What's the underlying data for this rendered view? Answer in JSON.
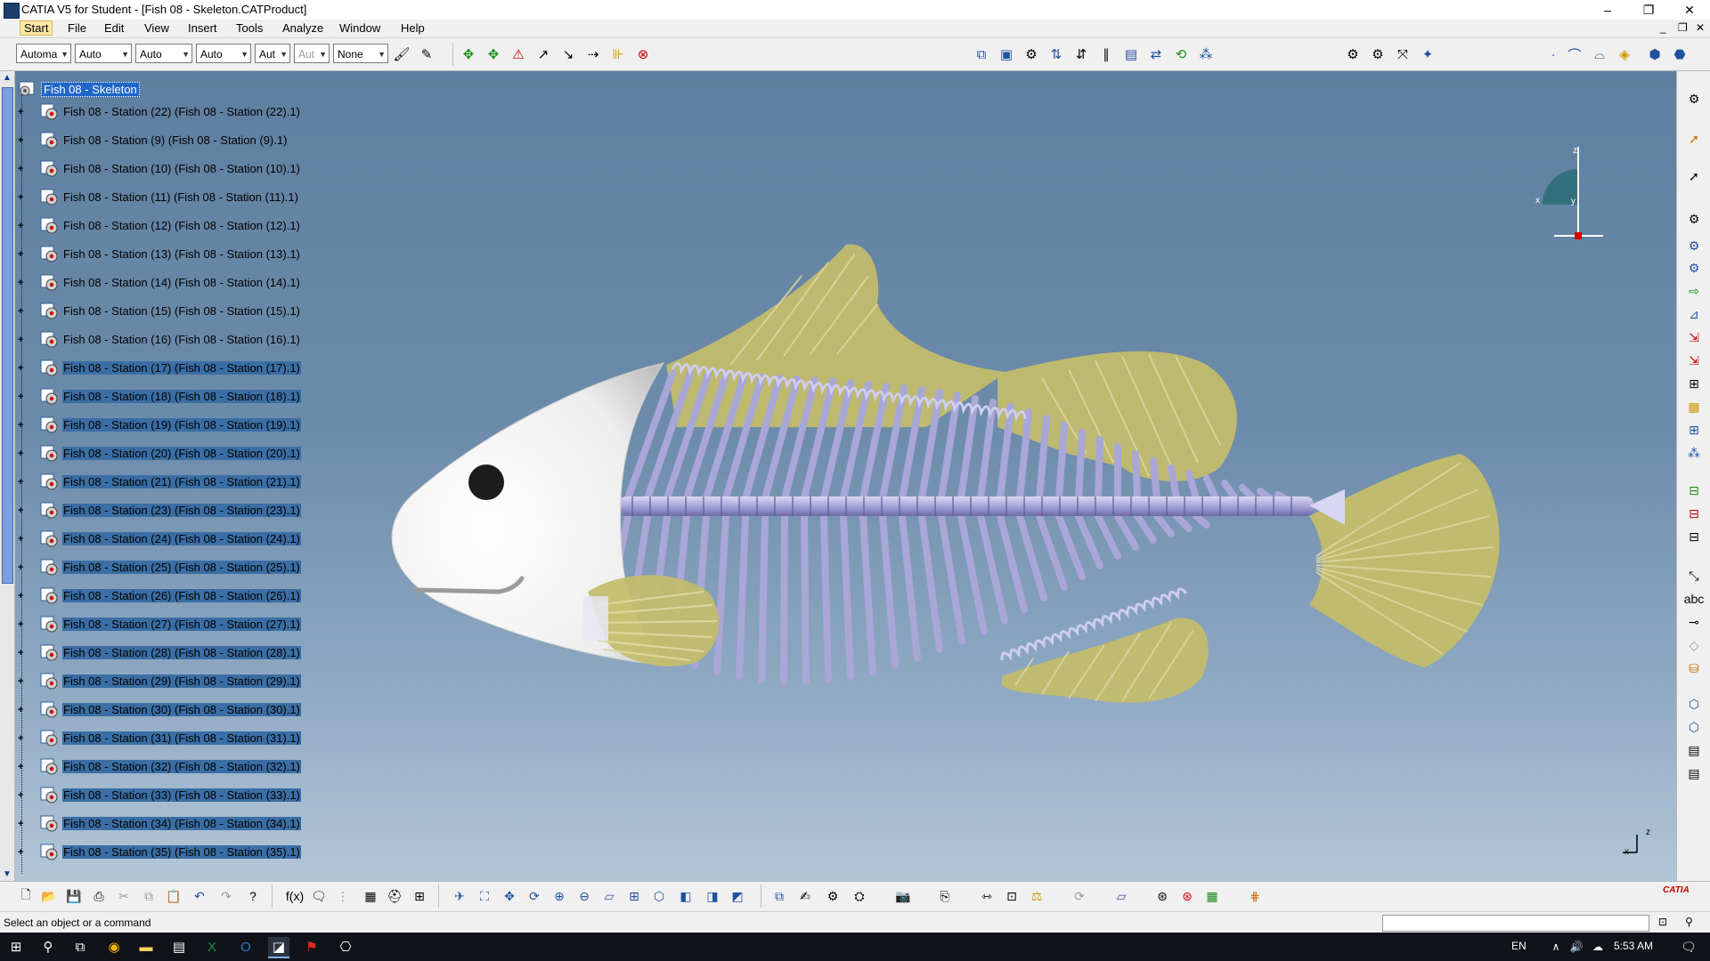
{
  "window": {
    "title": "CATIA V5 for Student - [Fish 08 - Skeleton.CATProduct]",
    "controls": {
      "minimize": "–",
      "restore": "❐",
      "close": "✕"
    }
  },
  "menu": {
    "items": [
      "Start",
      "File",
      "Edit",
      "View",
      "Insert",
      "Tools",
      "Analyze",
      "Window",
      "Help"
    ],
    "mdi_controls": {
      "minimize": "_",
      "restore": "❐",
      "close": "✕"
    }
  },
  "toolbar": {
    "combos": [
      {
        "value": "Automa",
        "disabled": false
      },
      {
        "value": "Auto",
        "disabled": false
      },
      {
        "value": "Auto",
        "disabled": false
      },
      {
        "value": "Auto",
        "disabled": false
      },
      {
        "value": "Aut",
        "disabled": false
      },
      {
        "value": "Aut",
        "disabled": true
      },
      {
        "value": "None",
        "disabled": false
      }
    ]
  },
  "tree": {
    "root": "Fish 08 - Skeleton",
    "items": [
      "Fish 08 - Station (22) (Fish 08 - Station (22).1)",
      "Fish 08 - Station (9) (Fish 08 - Station (9).1)",
      "Fish 08 - Station (10) (Fish 08 - Station (10).1)",
      "Fish 08 - Station (11) (Fish 08 - Station (11).1)",
      "Fish 08 - Station (12) (Fish 08 - Station (12).1)",
      "Fish 08 - Station (13) (Fish 08 - Station (13).1)",
      "Fish 08 - Station (14) (Fish 08 - Station (14).1)",
      "Fish 08 - Station (15) (Fish 08 - Station (15).1)",
      "Fish 08 - Station (16) (Fish 08 - Station (16).1)",
      "Fish 08 - Station (17) (Fish 08 - Station (17).1)",
      "Fish 08 - Station (18) (Fish 08 - Station (18).1)",
      "Fish 08 - Station (19) (Fish 08 - Station (19).1)",
      "Fish 08 - Station (20) (Fish 08 - Station (20).1)",
      "Fish 08 - Station (21) (Fish 08 - Station (21).1)",
      "Fish 08 - Station (23) (Fish 08 - Station (23).1)",
      "Fish 08 - Station (24) (Fish 08 - Station (24).1)",
      "Fish 08 - Station (25) (Fish 08 - Station (25).1)",
      "Fish 08 - Station (26) (Fish 08 - Station (26).1)",
      "Fish 08 - Station (27) (Fish 08 - Station (27).1)",
      "Fish 08 - Station (28) (Fish 08 - Station (28).1)",
      "Fish 08 - Station (29) (Fish 08 - Station (29).1)",
      "Fish 08 - Station (30) (Fish 08 - Station (30).1)",
      "Fish 08 - Station (31) (Fish 08 - Station (31).1)",
      "Fish 08 - Station (32) (Fish 08 - Station (32).1)",
      "Fish 08 - Station (33) (Fish 08 - Station (33).1)",
      "Fish 08 - Station (34) (Fish 08 - Station (34).1)",
      "Fish 08 - Station (35) (Fish 08 - Station (35).1)"
    ]
  },
  "compass": {
    "x": "x",
    "y": "y",
    "z": "z"
  },
  "axis_triad": {
    "x": "x",
    "z": "z"
  },
  "brand": "CATIA",
  "status": {
    "message": "Select an object or a command"
  },
  "taskbar": {
    "language": "EN",
    "time": "5:53 AM"
  },
  "colors": {
    "viewport_top": "#5f7fa0",
    "viewport_bottom": "#b3c6d8",
    "fin": "#c4bd6a",
    "bone": "#a9a6d8",
    "head": "#ffffff",
    "selection": "#1f66c8"
  }
}
